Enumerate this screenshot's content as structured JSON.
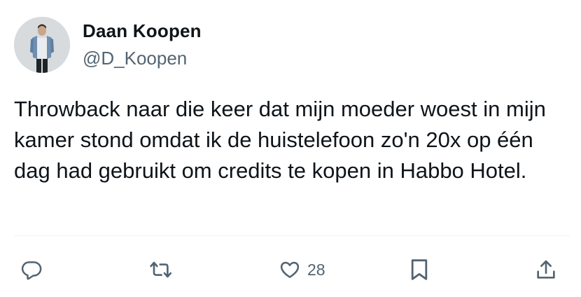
{
  "author": {
    "display_name": "Daan Koopen",
    "handle": "@D_Koopen"
  },
  "tweet": {
    "text": "Throwback naar die keer dat mijn moeder woest in mijn kamer stond omdat ik de huistelefoon zo'n 20x op één dag had gebruikt om credits te kopen in Habbo Hotel."
  },
  "actions": {
    "reply_icon": "speech-bubble-icon",
    "retweet_icon": "retweet-arrows-icon",
    "like_icon": "heart-icon",
    "like_count": "28",
    "bookmark_icon": "bookmark-icon",
    "share_icon": "share-upload-icon"
  },
  "colors": {
    "text_primary": "#0f1419",
    "text_secondary": "#536471",
    "divider": "#eff3f4"
  }
}
